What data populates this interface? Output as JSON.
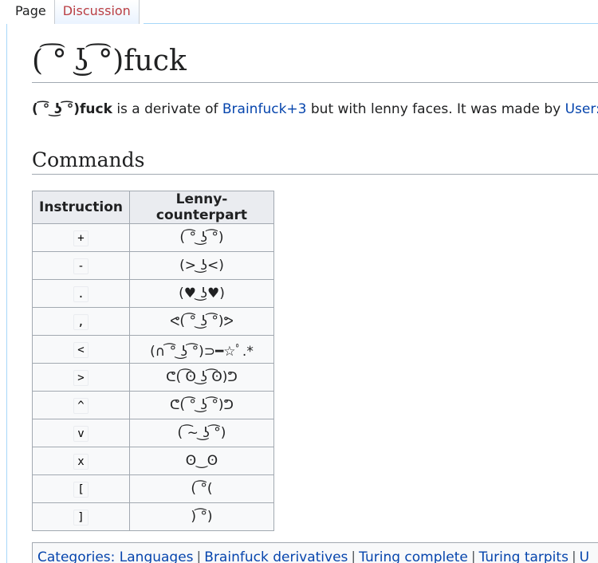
{
  "tabs": [
    {
      "label": "Page"
    },
    {
      "label": "Discussion"
    }
  ],
  "page": {
    "title": "( ͡° ͜ʖ ͡°)fuck"
  },
  "intro": {
    "bold_name": "( ͡° ͜ʖ ͡°)fuck",
    "text1": " is a derivate of ",
    "link1": "Brainfuck+3",
    "text2": " but with lenny faces. It was made by ",
    "link2": "User:ivan"
  },
  "commands_section": {
    "heading": "Commands",
    "columns": [
      "Instruction",
      "Lenny-counterpart"
    ],
    "rows": [
      {
        "instruction": "+",
        "lenny": "( ͡° ͜ʖ ͡°)"
      },
      {
        "instruction": "-",
        "lenny": "(> ͜ʖ<)"
      },
      {
        "instruction": ".",
        "lenny": "(♥ ͜ʖ♥)"
      },
      {
        "instruction": ",",
        "lenny": "ᕙ( ͡° ͜ʖ ͡°)ᕗ"
      },
      {
        "instruction": "<",
        "lenny": "(∩ ͡° ͜ʖ ͡°)⊃━☆ﾟ.*"
      },
      {
        "instruction": ">",
        "lenny": "ᕦ( ͡ʘ ͜ʖ ͡ʘ)ᕤ"
      },
      {
        "instruction": "^",
        "lenny": "ᕦ( ͡° ͜ʖ ͡°)ᕤ"
      },
      {
        "instruction": "v",
        "lenny": "( ͡~ ͜ʖ ͡°)"
      },
      {
        "instruction": "x",
        "lenny": "ʘ‿ʘ"
      },
      {
        "instruction": "[",
        "lenny": "( ͡°("
      },
      {
        "instruction": "]",
        "lenny": ") ͡°)"
      }
    ]
  },
  "categories": {
    "label": "Categories:",
    "items": [
      "Languages",
      "Brainfuck derivatives",
      "Turing complete",
      "Turing tarpits",
      "U"
    ]
  },
  "colors": {
    "link": "#0645ad",
    "tab_inactive": "#ba3f44",
    "table_header": "#eaecf0",
    "border": "#a2a9b1"
  }
}
